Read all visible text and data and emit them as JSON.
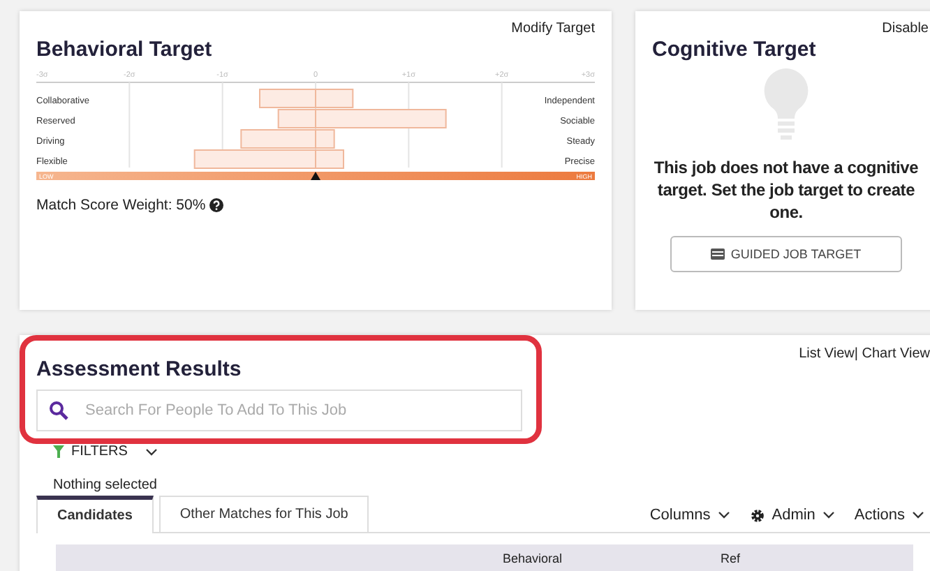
{
  "behavioral": {
    "title": "Behavioral Target",
    "action": "Modify Target",
    "chart_data": {
      "type": "bar",
      "orientation": "horizontal",
      "stacked": true,
      "grid": true,
      "categories": [
        "Collaborative",
        "Reserved",
        "Driving",
        "Flexible"
      ],
      "xlim": [
        -3,
        3
      ],
      "xticks": [
        {
          "value": -3,
          "label": "-3σ"
        },
        {
          "value": -2,
          "label": "-2σ"
        },
        {
          "value": -1,
          "label": "-1σ"
        },
        {
          "value": 0,
          "label": "0"
        },
        {
          "value": 1,
          "label": "+1σ"
        },
        {
          "value": 2,
          "label": "+2σ"
        },
        {
          "value": 3,
          "label": "+3σ"
        }
      ],
      "series": [
        {
          "color": "#fdebe3",
          "values": [
            -0.6,
            -0.4,
            -0.8,
            -1.3
          ]
        },
        {
          "color": "#fdebe3",
          "values": [
            0.4,
            1.4,
            0.2,
            0.3
          ]
        }
      ]
    },
    "right_labels": [
      "Independent",
      "Sociable",
      "Steady",
      "Precise"
    ],
    "scale": {
      "low": "LOW",
      "high": "HIGH",
      "level": 0.5
    },
    "weight": "Match Score Weight: 50%"
  },
  "cognitive": {
    "title": "Cognitive Target",
    "action": "Disable",
    "message": "This job does not have a cognitive target. Set the job target to create one.",
    "button": "GUIDED JOB TARGET"
  },
  "results": {
    "title": "Assessment Results",
    "views": "List View| Chart View",
    "search": {
      "placeholder": "Search For People To Add To This Job"
    },
    "filters": "FILTERS",
    "selection": "Nothing selected",
    "tabs": [
      {
        "label": "Candidates",
        "selected": true
      },
      {
        "label": "Other Matches for This Job",
        "selected": false
      }
    ],
    "menus": [
      {
        "label": "Columns",
        "kind": "plain"
      },
      {
        "label": "Admin",
        "kind": "gear"
      },
      {
        "label": "Actions",
        "kind": "plain"
      }
    ],
    "columns": [
      "Behavioral",
      "Ref"
    ]
  }
}
